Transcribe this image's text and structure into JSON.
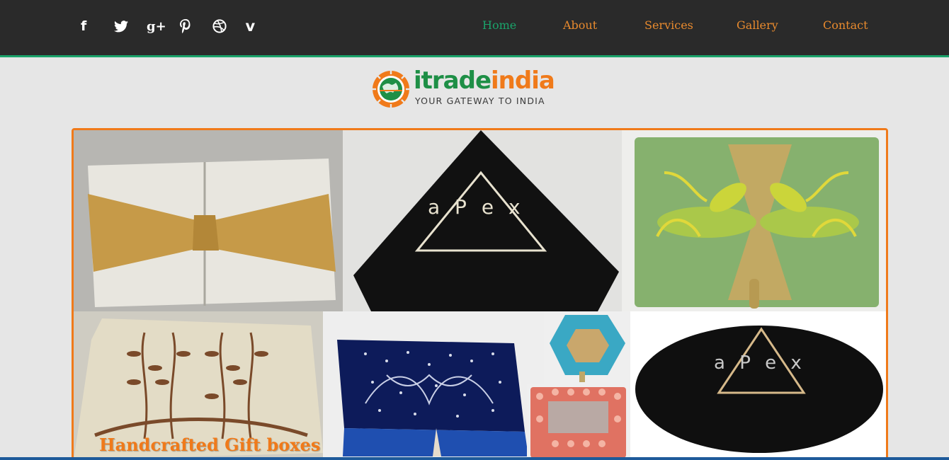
{
  "social": {
    "icons": [
      {
        "name": "facebook-icon",
        "glyph": "f"
      },
      {
        "name": "twitter-icon",
        "glyph": ""
      },
      {
        "name": "google-plus-icon",
        "glyph": "g+"
      },
      {
        "name": "pinterest-icon",
        "glyph": ""
      },
      {
        "name": "dribbble-icon",
        "glyph": ""
      },
      {
        "name": "vimeo-icon",
        "glyph": "v"
      }
    ]
  },
  "nav": {
    "items": [
      {
        "label": "Home",
        "active": true
      },
      {
        "label": "About",
        "active": false
      },
      {
        "label": "Services",
        "active": false
      },
      {
        "label": "Gallery",
        "active": false
      },
      {
        "label": "Contact",
        "active": false
      }
    ]
  },
  "logo": {
    "word_part1": "itrade",
    "word_part2": "india",
    "tagline": "YOUR GATEWAY TO INDIA"
  },
  "gallery": {
    "caption": "Handcrafted Gift boxes",
    "photo_texts": {
      "apex_top": "a P e x",
      "apex_bottom": "a P e x"
    }
  },
  "colors": {
    "accent_orange": "#f07a1a",
    "accent_green": "#1aa36a",
    "topbar": "#2a2a2a"
  }
}
